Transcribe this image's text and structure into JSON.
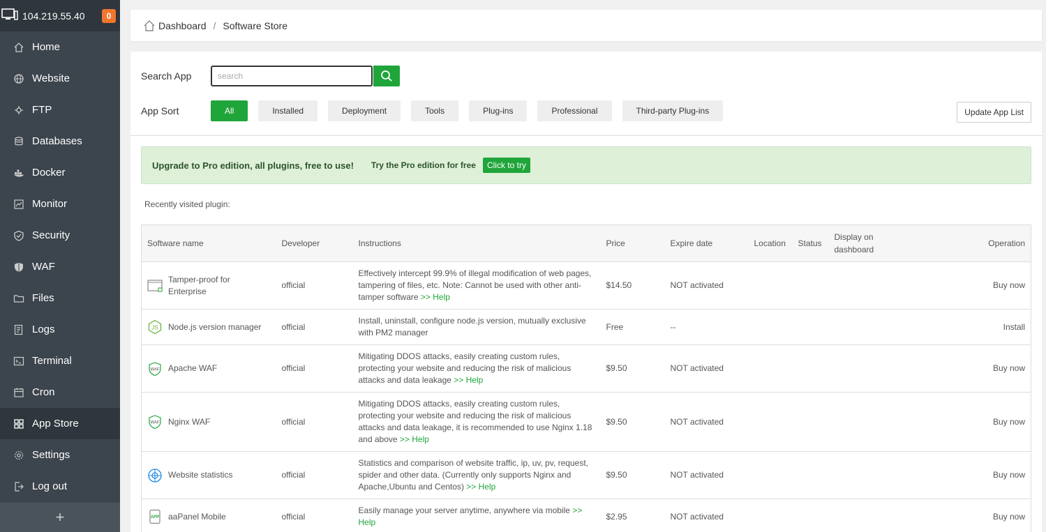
{
  "sidebar": {
    "ip": "104.219.55.40",
    "badge": "0",
    "items": [
      {
        "label": "Home",
        "icon": "home-icon"
      },
      {
        "label": "Website",
        "icon": "globe-icon"
      },
      {
        "label": "FTP",
        "icon": "ftp-icon"
      },
      {
        "label": "Databases",
        "icon": "database-icon"
      },
      {
        "label": "Docker",
        "icon": "docker-icon"
      },
      {
        "label": "Monitor",
        "icon": "monitor-icon"
      },
      {
        "label": "Security",
        "icon": "shield-icon"
      },
      {
        "label": "WAF",
        "icon": "waf-icon"
      },
      {
        "label": "Files",
        "icon": "folder-icon"
      },
      {
        "label": "Logs",
        "icon": "logs-icon"
      },
      {
        "label": "Terminal",
        "icon": "terminal-icon"
      },
      {
        "label": "Cron",
        "icon": "calendar-icon"
      },
      {
        "label": "App Store",
        "icon": "grid-icon"
      },
      {
        "label": "Settings",
        "icon": "gear-icon"
      },
      {
        "label": "Log out",
        "icon": "logout-icon"
      }
    ],
    "add": "+"
  },
  "breadcrumb": {
    "home": "Dashboard",
    "sep": "/",
    "current": "Software Store"
  },
  "search": {
    "label": "Search App",
    "placeholder": "search"
  },
  "sort": {
    "label": "App Sort",
    "options": [
      "All",
      "Installed",
      "Deployment",
      "Tools",
      "Plug-ins",
      "Professional",
      "Third-party Plug-ins"
    ]
  },
  "update_btn": "Update App List",
  "promo": {
    "text": "Upgrade to Pro edition, all plugins, free to use!",
    "try_text": "Try the Pro edition for free",
    "button": "Click to try"
  },
  "recent": "Recently visited plugin:",
  "table": {
    "headers": [
      "Software name",
      "Developer",
      "Instructions",
      "Price",
      "Expire date",
      "Location",
      "Status",
      "Display on dashboard",
      "Operation"
    ],
    "rows": [
      {
        "name": "Tamper-proof for Enterprise",
        "dev": "official",
        "desc": "Effectively intercept 99.9% of illegal modification of web pages, tampering of files, etc. Note: Cannot be used with other anti-tamper software",
        "help": ">> Help",
        "price": "$14.50",
        "expire": "NOT activated",
        "op": "Buy now"
      },
      {
        "name": "Node.js version manager",
        "dev": "official",
        "desc": "Install, uninstall, configure node.js version, mutually exclusive with PM2 manager",
        "help": "",
        "price": "Free",
        "expire": "--",
        "op": "Install"
      },
      {
        "name": "Apache WAF",
        "dev": "official",
        "desc": "Mitigating DDOS attacks, easily creating custom rules, protecting your website and reducing the risk of malicious attacks and data leakage",
        "help": ">> Help",
        "price": "$9.50",
        "expire": "NOT activated",
        "op": "Buy now"
      },
      {
        "name": "Nginx WAF",
        "dev": "official",
        "desc": "Mitigating DDOS attacks, easily creating custom rules, protecting your website and reducing the risk of malicious attacks and data leakage, it is recommended to use Nginx 1.18 and above",
        "help": ">> Help",
        "price": "$9.50",
        "expire": "NOT activated",
        "op": "Buy now"
      },
      {
        "name": "Website statistics",
        "dev": "official",
        "desc": "Statistics and comparison of website traffic, ip, uv, pv, request, spider and other data. (Currently only supports Nginx and Apache,Ubuntu and Centos)",
        "help": ">> Help",
        "price": "$9.50",
        "expire": "NOT activated",
        "op": "Buy now"
      },
      {
        "name": "aaPanel Mobile",
        "dev": "official",
        "desc": "Easily manage your server anytime, anywhere via mobile",
        "help": ">> Help",
        "price": "$2.95",
        "expire": "NOT activated",
        "op": "Buy now"
      }
    ]
  }
}
